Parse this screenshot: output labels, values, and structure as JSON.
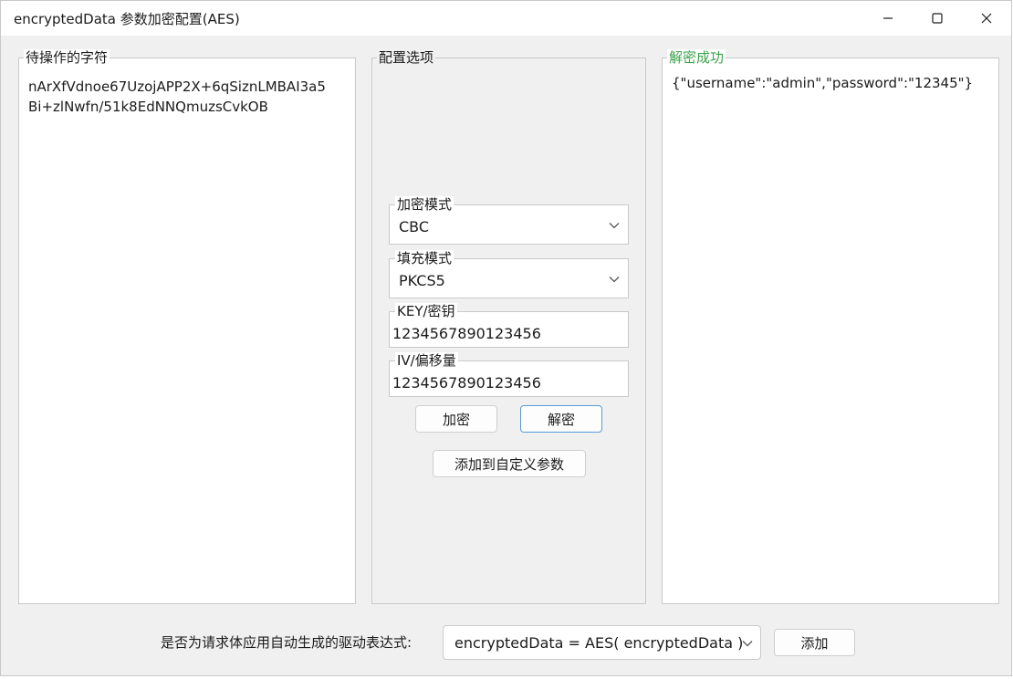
{
  "window": {
    "title": "encryptedData 参数加密配置(AES)"
  },
  "input_panel": {
    "label": "待操作的字符",
    "lines": [
      "nArXfVdnoe67UzojAPP2X+6qSiznLMBAI3a5",
      "Bi+zlNwfn/51k8EdNNQmuzsCvkOB"
    ]
  },
  "config_panel": {
    "label": "配置选项",
    "mode": {
      "label": "加密模式",
      "value": "CBC"
    },
    "padding": {
      "label": "填充模式",
      "value": "PKCS5"
    },
    "key": {
      "label": "KEY/密钥",
      "value": "1234567890123456"
    },
    "iv": {
      "label": "IV/偏移量",
      "value": "1234567890123456"
    },
    "encrypt_label": "加密",
    "decrypt_label": "解密",
    "add_custom_label": "添加到自定义参数"
  },
  "result_panel": {
    "label": "解密成功",
    "text": "{\"username\":\"admin\",\"password\":\"12345\"}",
    "label_color": "#3aa34a"
  },
  "footer": {
    "question": "是否为请求体应用自动生成的驱动表达式:",
    "expression": "encryptedData = AES( encryptedData )",
    "add_label": "添加"
  }
}
